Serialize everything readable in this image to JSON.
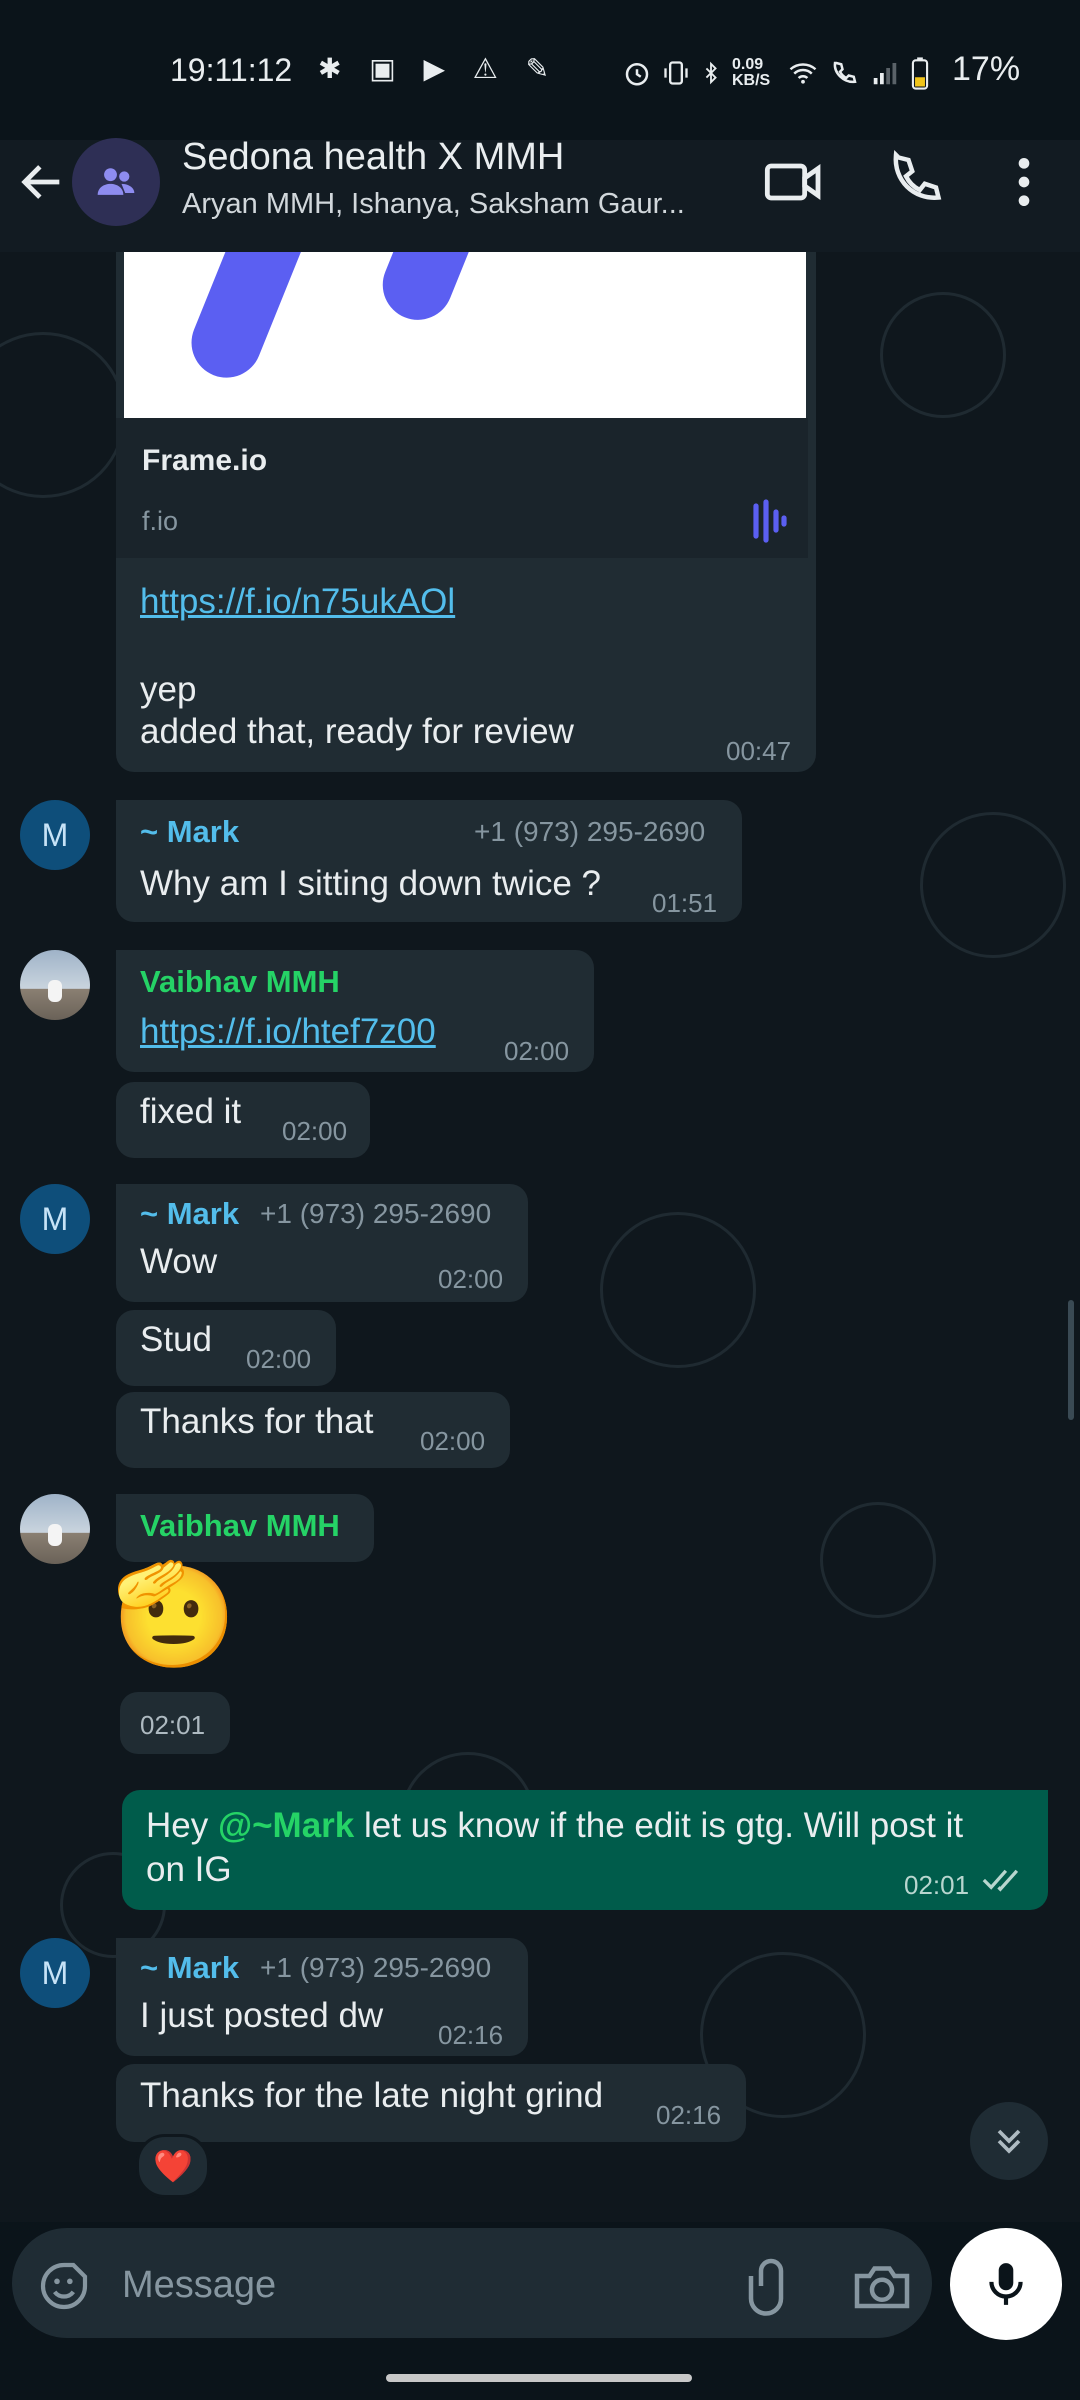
{
  "status_bar": {
    "time": "19:11:12",
    "left_icons": "✱ ▣ ▶ ⚠ ✎",
    "net_speed": "0.09 KB/S",
    "battery": "17%"
  },
  "header": {
    "title": "Sedona health X MMH",
    "subtitle": "Aryan MMH, Ishanya, Saksham Gaur..."
  },
  "messages": {
    "link_preview": {
      "title": "Frame.io",
      "domain": "f.io"
    },
    "m1": {
      "link": "https://f.io/n75ukAOl",
      "line1": "yep",
      "line2": "added that, ready for review",
      "time": "00:47"
    },
    "m2": {
      "sender": "~ Mark",
      "phone": "+1 (973) 295-2690",
      "text": "Why am I sitting down twice ?",
      "time": "01:51"
    },
    "m3": {
      "sender": "Vaibhav MMH",
      "link": "https://f.io/htef7z00",
      "time": "02:00"
    },
    "m4": {
      "text": "fixed it",
      "time": "02:00"
    },
    "m5": {
      "sender": "~ Mark",
      "phone": "+1 (973) 295-2690",
      "text": "Wow",
      "time": "02:00"
    },
    "m6": {
      "text": "Stud",
      "time": "02:00"
    },
    "m7": {
      "text": "Thanks for that",
      "time": "02:00"
    },
    "m8": {
      "sender": "Vaibhav MMH",
      "emoji": "🫡",
      "time": "02:01"
    },
    "m9": {
      "prefix": "Hey ",
      "mention": "@~Mark",
      "rest": " let us know if the edit is gtg. Will post it",
      "line2": "on IG",
      "time": "02:01"
    },
    "m10": {
      "sender": "~ Mark",
      "phone": "+1 (973) 295-2690",
      "text": "I just posted dw",
      "time": "02:16"
    },
    "m11": {
      "text": "Thanks for the late night grind",
      "time": "02:16",
      "reaction": "❤️"
    }
  },
  "avatars": {
    "mark_initial": "M"
  },
  "input": {
    "placeholder": "Message"
  },
  "colors": {
    "incoming": "#202c33",
    "outgoing": "#005c4b",
    "link": "#53bdeb",
    "sender_green": "#25d366",
    "sender_blue": "#53bdeb"
  }
}
